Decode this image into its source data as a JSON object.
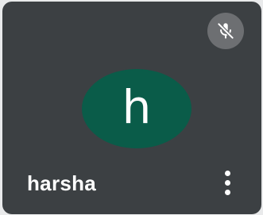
{
  "participant": {
    "name": "harsha",
    "initial": "h",
    "avatar_color": "#0a5c49",
    "mic_muted": true
  },
  "icons": {
    "mute": "mic-off-icon",
    "more": "more-vert-icon"
  },
  "colors": {
    "tile_background": "#3c4043",
    "mute_badge": "#6d6f72"
  }
}
